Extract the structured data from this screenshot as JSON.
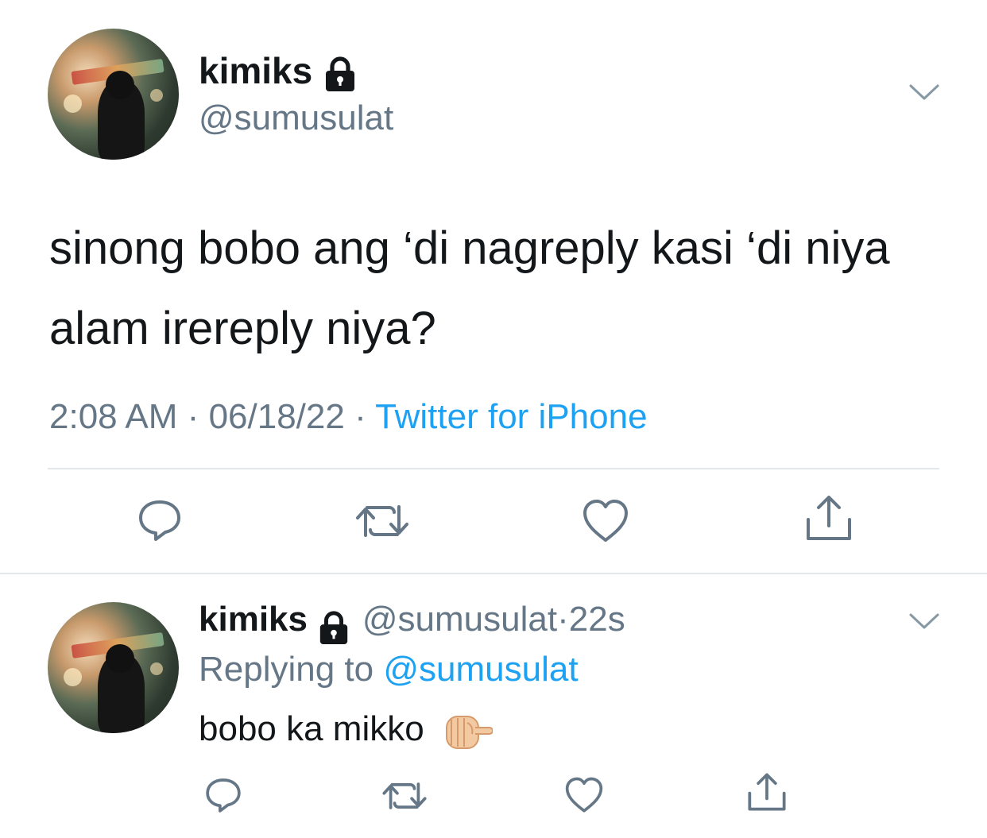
{
  "main_tweet": {
    "display_name": "kimiks",
    "handle": "@sumusulat",
    "text": "sinong bobo ang ‘di nagreply kasi ‘di niya alam irereply niya?",
    "time": "2:08 AM",
    "date": "06/18/22",
    "separator": "·",
    "source": "Twitter for iPhone",
    "icons": [
      "lock-icon",
      "chevron-down-icon",
      "reply-icon",
      "retweet-icon",
      "like-icon",
      "share-icon"
    ]
  },
  "reply_tweet": {
    "display_name": "kimiks",
    "handle": "@sumusulat",
    "dot": "·",
    "age": "22s",
    "replying_prefix": "Replying to",
    "replying_to": "@sumusulat",
    "text": "bobo ka mikko",
    "emoji": "fist-pointing-icon"
  },
  "colors": {
    "text": "#14171a",
    "secondary": "#657786",
    "link": "#1da1f2",
    "divider": "#e1e8ed",
    "icon": "#657786"
  }
}
